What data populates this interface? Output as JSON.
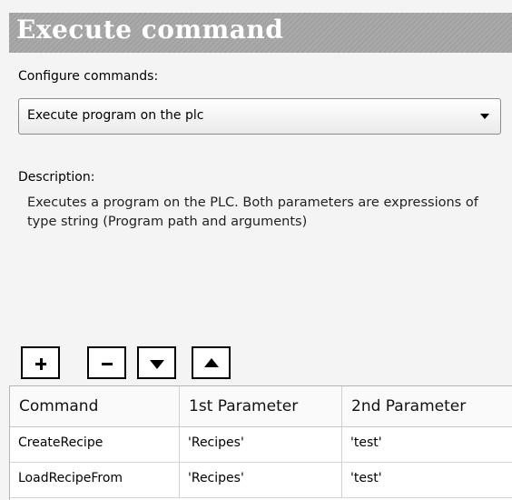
{
  "header": {
    "title": "Execute command"
  },
  "config": {
    "label": "Configure commands:",
    "selected_value": "Execute program on the plc"
  },
  "description": {
    "label": "Description:",
    "text": "Executes a program on the PLC. Both parameters are expressions of type string (Program path and arguments)"
  },
  "toolbar": {
    "buttons": [
      {
        "name": "add",
        "icon": "plus-icon"
      },
      {
        "name": "remove",
        "icon": "minus-icon"
      },
      {
        "name": "move-down",
        "icon": "triangle-down-icon"
      },
      {
        "name": "move-up",
        "icon": "triangle-up-icon"
      }
    ]
  },
  "table": {
    "columns": [
      "Command",
      "1st Parameter",
      "2nd Parameter"
    ],
    "rows": [
      [
        "CreateRecipe",
        "'Recipes'",
        "'test'"
      ],
      [
        "LoadRecipeFrom",
        "'Recipes'",
        "'test'"
      ]
    ]
  }
}
